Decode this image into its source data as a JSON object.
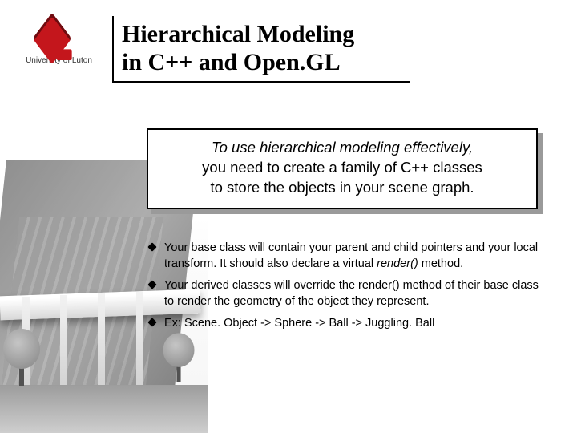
{
  "logo": {
    "caption": "University of Luton"
  },
  "title": {
    "line1": "Hierarchical Modeling",
    "line2": "in C++ and Open.GL"
  },
  "callout": {
    "line1": "To use hierarchical modeling effectively,",
    "line2": "you need to create a family of C++ classes",
    "line3": "to store the objects in your scene graph."
  },
  "bullets": [
    {
      "pre": "Your base class will contain your parent and child pointers and your local transform.  It should also declare a virtual ",
      "em": "render()",
      "post": "  method."
    },
    {
      "pre": "Your derived classes will override the render() method of their base class to render the geometry of the object they represent.",
      "em": "",
      "post": ""
    },
    {
      "pre": "Ex: Scene. Object -> Sphere -> Ball -> Juggling. Ball",
      "em": "",
      "post": ""
    }
  ]
}
